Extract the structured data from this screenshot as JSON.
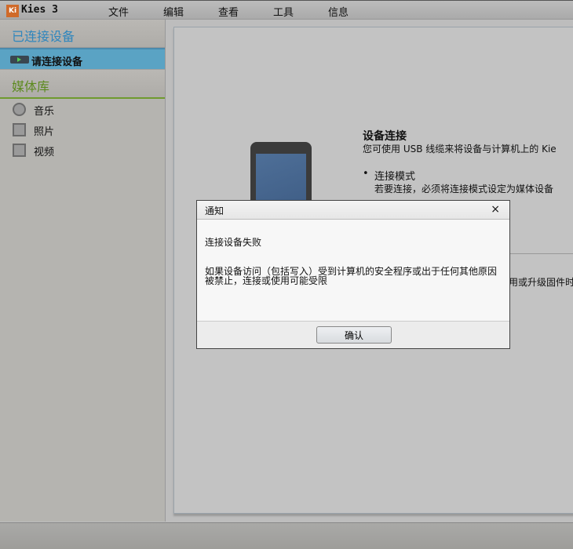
{
  "app": {
    "title": "Kies 3",
    "logo_text": "Ki"
  },
  "menu": [
    "文件",
    "编辑",
    "查看",
    "工具",
    "信息"
  ],
  "sidebar": {
    "connected_header": "已连接设备",
    "connect_item": "请连接设备",
    "library_header": "媒体库",
    "items": [
      {
        "label": "音乐",
        "icon": "music-icon"
      },
      {
        "label": "照片",
        "icon": "photo-icon"
      },
      {
        "label": "视频",
        "icon": "video-icon"
      }
    ]
  },
  "main": {
    "title": "设备连接",
    "desc": "您可使用 USB 线缆来将设备与计算机上的 Kie",
    "bullet_title": "连接模式",
    "bullet_desc": "若要连接，必须将连接模式设定为媒体设备",
    "partial_text": "用或升级固件时"
  },
  "dialog": {
    "title": "通知",
    "message": "连接设备失败",
    "detail": "如果设备访问（包括写入）受到计算机的安全程序或出于任何其他原因被禁止，连接或使用可能受限",
    "ok_label": "确认",
    "close_glyph": "×"
  }
}
